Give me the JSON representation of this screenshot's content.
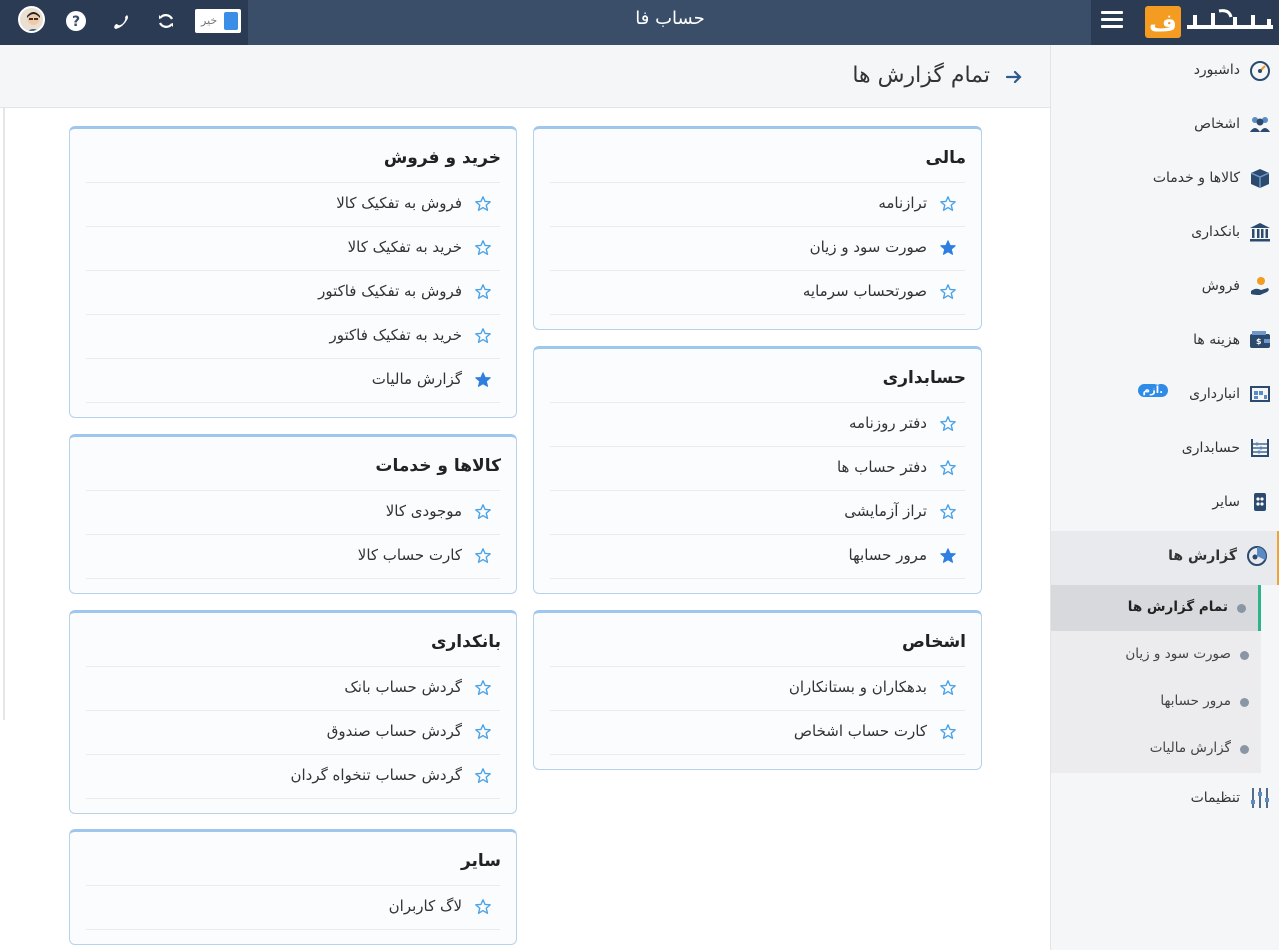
{
  "topbar": {
    "app_title": "حساب فا",
    "toggle_label": "خیر"
  },
  "page": {
    "title": "تمام گزارش ها"
  },
  "cards": {
    "mali": {
      "title": "مالی",
      "items": [
        {
          "label": "ترازنامه",
          "starred": false
        },
        {
          "label": "صورت سود و زیان",
          "starred": true
        },
        {
          "label": "صورتحساب سرمایه",
          "starred": false
        }
      ]
    },
    "kharid": {
      "title": "خرید و فروش",
      "items": [
        {
          "label": "فروش به تفکیک کالا",
          "starred": false
        },
        {
          "label": "خرید به تفکیک کالا",
          "starred": false
        },
        {
          "label": "فروش به تفکیک فاکتور",
          "starred": false
        },
        {
          "label": "خرید به تفکیک فاکتور",
          "starred": false
        },
        {
          "label": "گزارش مالیات",
          "starred": true
        }
      ]
    },
    "hesabdari": {
      "title": "حسابداری",
      "items": [
        {
          "label": "دفتر روزنامه",
          "starred": false
        },
        {
          "label": "دفتر حساب ها",
          "starred": false
        },
        {
          "label": "تراز آزمایشی",
          "starred": false
        },
        {
          "label": "مرور حسابها",
          "starred": true
        }
      ]
    },
    "kala": {
      "title": "کالاها و خدمات",
      "items": [
        {
          "label": "موجودی کالا",
          "starred": false
        },
        {
          "label": "کارت حساب کالا",
          "starred": false
        }
      ]
    },
    "ashkhas": {
      "title": "اشخاص",
      "items": [
        {
          "label": "بدهکاران و بستانکاران",
          "starred": false
        },
        {
          "label": "کارت حساب اشخاص",
          "starred": false
        }
      ]
    },
    "bank": {
      "title": "بانکداری",
      "items": [
        {
          "label": "گردش حساب بانک",
          "starred": false
        },
        {
          "label": "گردش حساب صندوق",
          "starred": false
        },
        {
          "label": "گردش حساب تنخواه گردان",
          "starred": false
        }
      ]
    },
    "sayer": {
      "title": "سایر",
      "items": [
        {
          "label": "لاگ کاربران",
          "starred": false
        }
      ]
    }
  },
  "sidebar": {
    "items": [
      {
        "label": "داشبورد",
        "icon": "dashboard-icon"
      },
      {
        "label": "اشخاص",
        "icon": "people-icon"
      },
      {
        "label": "کالاها و خدمات",
        "icon": "box-icon"
      },
      {
        "label": "بانکداری",
        "icon": "bank-icon"
      },
      {
        "label": "فروش",
        "icon": "sales-icon"
      },
      {
        "label": "هزینه ها",
        "icon": "wallet-icon"
      },
      {
        "label": "انبارداری",
        "icon": "warehouse-icon",
        "badge": "آزم."
      },
      {
        "label": "حسابداری",
        "icon": "abacus-icon"
      },
      {
        "label": "سایر",
        "icon": "other-icon"
      },
      {
        "label": "گزارش ها",
        "icon": "reports-icon"
      },
      {
        "label": "تنظیمات",
        "icon": "sliders-icon"
      }
    ],
    "sub_items": [
      {
        "label": "تمام گزارش ها"
      },
      {
        "label": "صورت سود و زیان"
      },
      {
        "label": "مرور حسابها"
      },
      {
        "label": "گزارش مالیات"
      }
    ]
  },
  "colors": {
    "topbar": "#3a4e6a",
    "accent": "#3a8ee6",
    "star_filled": "#2e7fe0",
    "star_outline": "#4aa3e8",
    "active_reports": "#f0a23a",
    "active_sub": "#2bb38a"
  }
}
